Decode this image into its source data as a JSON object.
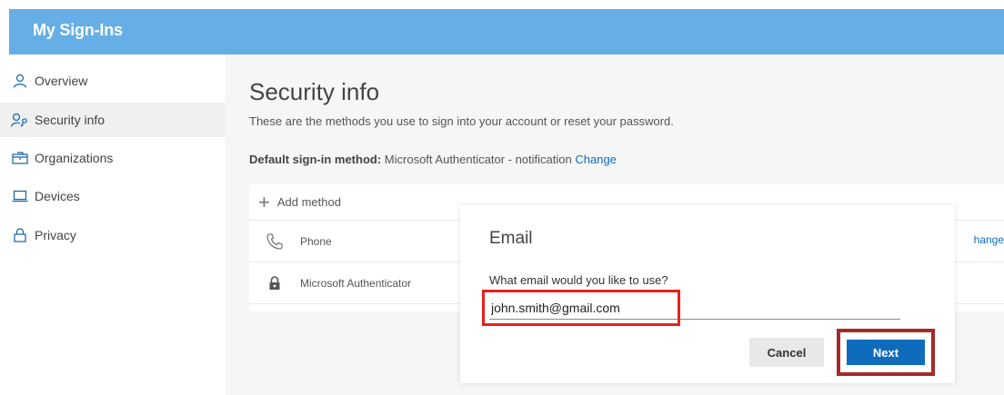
{
  "app": {
    "title": "My Sign-Ins"
  },
  "sidebar": {
    "items": [
      {
        "label": "Overview",
        "icon": "person-icon"
      },
      {
        "label": "Security info",
        "icon": "person-key-icon",
        "active": true
      },
      {
        "label": "Organizations",
        "icon": "building-icon"
      },
      {
        "label": "Devices",
        "icon": "laptop-icon"
      },
      {
        "label": "Privacy",
        "icon": "lock-icon"
      }
    ]
  },
  "main": {
    "title": "Security info",
    "subtitle": "These are the methods you use to sign into your account or reset your password.",
    "default_method": {
      "label": "Default sign-in method:",
      "value": "Microsoft Authenticator - notification",
      "change_link": "Change"
    },
    "add_method": "Add method",
    "methods": [
      {
        "name": "Phone",
        "icon": "phone-icon"
      },
      {
        "name": "Microsoft Authenticator",
        "icon": "authenticator-lock-icon"
      }
    ],
    "change_peek": "hange"
  },
  "dialog": {
    "title": "Email",
    "question": "What email would you like to use?",
    "email_value": "john.smith@gmail.com",
    "cancel_label": "Cancel",
    "next_label": "Next"
  },
  "colors": {
    "topbar": "#66aee6",
    "accent": "#0f6cbd",
    "highlight_input": "#e8201c",
    "highlight_next": "#a52a2a"
  }
}
